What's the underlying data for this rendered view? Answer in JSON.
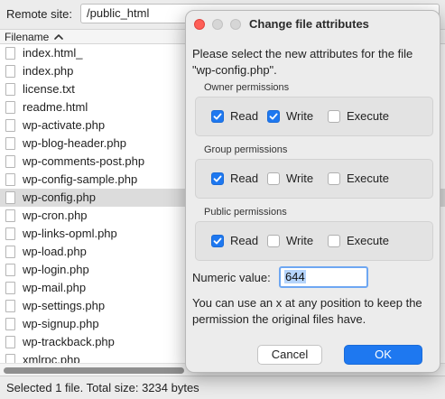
{
  "site_bar": {
    "label": "Remote site:",
    "path": "/public_html"
  },
  "list": {
    "column_header": "Filename",
    "files": [
      {
        "name": "index.html_",
        "selected": false
      },
      {
        "name": "index.php",
        "selected": false
      },
      {
        "name": "license.txt",
        "selected": false
      },
      {
        "name": "readme.html",
        "selected": false
      },
      {
        "name": "wp-activate.php",
        "selected": false
      },
      {
        "name": "wp-blog-header.php",
        "selected": false
      },
      {
        "name": "wp-comments-post.php",
        "selected": false
      },
      {
        "name": "wp-config-sample.php",
        "selected": false
      },
      {
        "name": "wp-config.php",
        "selected": true
      },
      {
        "name": "wp-cron.php",
        "selected": false
      },
      {
        "name": "wp-links-opml.php",
        "selected": false
      },
      {
        "name": "wp-load.php",
        "selected": false
      },
      {
        "name": "wp-login.php",
        "selected": false
      },
      {
        "name": "wp-mail.php",
        "selected": false
      },
      {
        "name": "wp-settings.php",
        "selected": false
      },
      {
        "name": "wp-signup.php",
        "selected": false
      },
      {
        "name": "wp-trackback.php",
        "selected": false
      },
      {
        "name": "xmlrpc.php",
        "selected": false
      }
    ]
  },
  "status": {
    "text": "Selected 1 file. Total size: 3234 bytes"
  },
  "dialog": {
    "title": "Change file attributes",
    "description": "Please select the new attributes for the file \"wp-config.php\".",
    "groups": [
      {
        "label": "Owner permissions",
        "read": true,
        "write": true,
        "execute": false
      },
      {
        "label": "Group permissions",
        "read": true,
        "write": false,
        "execute": false
      },
      {
        "label": "Public permissions",
        "read": true,
        "write": false,
        "execute": false
      }
    ],
    "checkbox_labels": {
      "read": "Read",
      "write": "Write",
      "execute": "Execute"
    },
    "numeric_label": "Numeric value:",
    "numeric_value": "644",
    "hint": "You can use an x at any position to keep the permission the original files have.",
    "cancel_label": "Cancel",
    "ok_label": "OK"
  },
  "colors": {
    "accent": "#1e78f0",
    "selected_row": "#dcdcdc",
    "close_button": "#fe5f57"
  }
}
